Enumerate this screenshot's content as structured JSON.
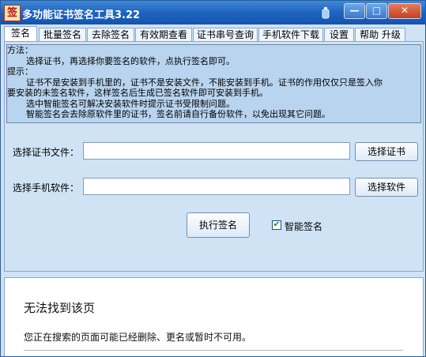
{
  "window": {
    "app_icon_glyph": "签",
    "title": "多功能证书签名工具3.22",
    "buttons": {
      "minimize": "—",
      "maximize": "□",
      "close": "✕"
    }
  },
  "tabs": [
    {
      "label": "签名",
      "active": true
    },
    {
      "label": "批量签名",
      "active": false
    },
    {
      "label": "去除签名",
      "active": false
    },
    {
      "label": "有效期查看",
      "active": false
    },
    {
      "label": "证书串号查询",
      "active": false
    },
    {
      "label": "手机软件下载",
      "active": false
    },
    {
      "label": "设置",
      "active": false
    },
    {
      "label": "帮助 升级",
      "active": false
    }
  ],
  "info": {
    "lines": [
      "方法：",
      "    选择证书，再选择你要签名的软件，点执行签名即可。",
      "提示：",
      "    证书不是安装到手机里的，证书不是安装文件，不能安装到手机。证书的作用仅仅只是签入你",
      "要安装的未签名软件，这样签名后生成已签名软件即可安装到手机。",
      "    选中智能签名可解决安装软件时提示证书受限制问题。",
      "    智能签名会去除原软件里的证书，签名前请自行备份软件，以免出现其它问题。"
    ]
  },
  "form": {
    "cert_label": "选择证书文件：",
    "cert_value": "",
    "cert_button": "选择证书",
    "software_label": "选择手机软件：",
    "software_value": "",
    "software_button": "选择软件",
    "execute_button": "执行签名",
    "smart_sign_label": "智能签名",
    "smart_sign_checked": true
  },
  "browser": {
    "error_title": "无法找到该页",
    "error_text": "您正在搜索的页面可能已经删除、更名或暂时不可用。"
  }
}
